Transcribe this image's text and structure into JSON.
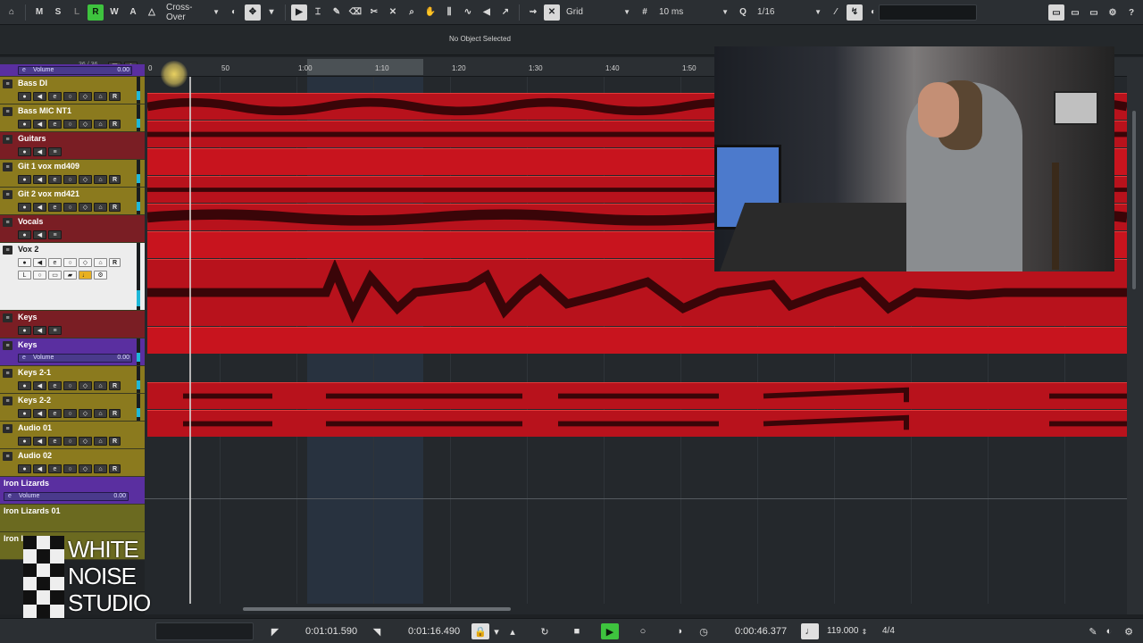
{
  "toolbar": {
    "m": "M",
    "s": "S",
    "l": "L",
    "r": "R",
    "w": "W",
    "a": "A",
    "crossover": "Cross-Over",
    "snap_mode": "Grid",
    "grid_ms": "10 ms",
    "quantize_label": "Q",
    "quantize": "1/16"
  },
  "infoline": {
    "text": "No Object Selected"
  },
  "header": {
    "count": "36 / 36"
  },
  "tracks": [
    {
      "name": "Volume",
      "type": "volume",
      "value": "0.00"
    },
    {
      "name": "Bass DI",
      "type": "audio"
    },
    {
      "name": "Bass MIC NT1",
      "type": "audio"
    },
    {
      "name": "Guitars",
      "type": "folder"
    },
    {
      "name": "Git 1 vox md409",
      "type": "audio"
    },
    {
      "name": "Git 2 vox md421",
      "type": "audio"
    },
    {
      "name": "Vocals",
      "type": "folder"
    },
    {
      "name": "Vox 2",
      "type": "selected"
    },
    {
      "name": "Keys",
      "type": "folder"
    },
    {
      "name": "Keys",
      "type": "group",
      "vol_label": "Volume",
      "value": "0.00"
    },
    {
      "name": "Keys 2-1",
      "type": "audio"
    },
    {
      "name": "Keys 2-2",
      "type": "audio"
    },
    {
      "name": "Audio 01",
      "type": "audio"
    },
    {
      "name": "Audio 02",
      "type": "audio"
    },
    {
      "name": "Iron Lizards",
      "type": "group",
      "vol_label": "Volume",
      "value": "0.00"
    },
    {
      "name": "Iron Lizards 01",
      "type": "instr"
    },
    {
      "name": "Iron I",
      "type": "instr"
    }
  ],
  "ruler": [
    "50",
    "1:00",
    "1:10",
    "1:20",
    "1:30",
    "1:40",
    "1:50"
  ],
  "logo": {
    "line1": "WHITE",
    "line2": "NOISE",
    "line3": "STUDIO"
  },
  "transport": {
    "left_locator": "0:01:01.590",
    "right_locator": "0:01:16.490",
    "position": "0:00:46.377",
    "tempo": "119.000",
    "signature": "4/4"
  },
  "colors": {
    "clip": "#b8121c",
    "play": "#3ec33e",
    "record": "#3ec33e",
    "meter": "#1fb8d8"
  }
}
